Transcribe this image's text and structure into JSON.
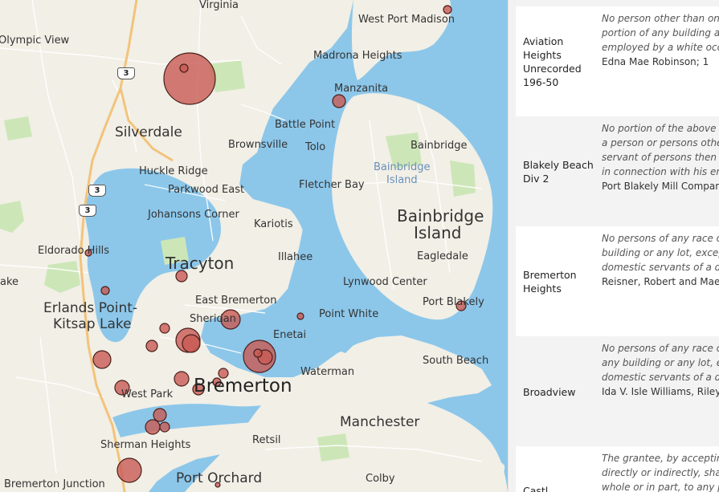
{
  "map": {
    "places": [
      {
        "name": "Virginia"
      },
      {
        "name": "West Port Madison"
      },
      {
        "name": "Olympic View"
      },
      {
        "name": "Madrona Heights"
      },
      {
        "name": "Manzanita"
      },
      {
        "name": "Silverdale"
      },
      {
        "name": "Battle Point"
      },
      {
        "name": "Brownsville"
      },
      {
        "name": "Tolo"
      },
      {
        "name": "Bainbridge"
      },
      {
        "name": "Huckle Ridge"
      },
      {
        "name": "Bainbridge"
      },
      {
        "name": "Island"
      },
      {
        "name": "Parkwood East"
      },
      {
        "name": "Fletcher Bay"
      },
      {
        "name": "Johansons Corner"
      },
      {
        "name": "Bainbridge"
      },
      {
        "name": "Island"
      },
      {
        "name": "Kariotis"
      },
      {
        "name": "Eldorado Hills"
      },
      {
        "name": "Tracyton"
      },
      {
        "name": "Illahee"
      },
      {
        "name": "Eagledale"
      },
      {
        "name": "Lynwood Center"
      },
      {
        "name": "ake"
      },
      {
        "name": "East Bremerton"
      },
      {
        "name": "Erlands Point-"
      },
      {
        "name": "Kitsap Lake"
      },
      {
        "name": "Port Blakely"
      },
      {
        "name": "Point White"
      },
      {
        "name": "Sheridan"
      },
      {
        "name": "Enetai"
      },
      {
        "name": "South Beach"
      },
      {
        "name": "Waterman"
      },
      {
        "name": "West Park"
      },
      {
        "name": "Bremerton"
      },
      {
        "name": "Manchester"
      },
      {
        "name": "Sherman Heights"
      },
      {
        "name": "Retsil"
      },
      {
        "name": "Port Orchard"
      },
      {
        "name": "Colby"
      },
      {
        "name": "Bremerton Junction"
      }
    ],
    "highways": [
      "3",
      "3",
      "3"
    ],
    "colors": {
      "water": "#8cc7ea",
      "land": "#f1efe6",
      "park": "#cde6b8",
      "road": "#ffffff",
      "highway": "#f3c37b",
      "marker": "#c85a54"
    }
  },
  "panel": {
    "rows": [
      {
        "name": "Aviation Heights Unrecorded 196-50",
        "lines": [
          "No person other than on",
          "portion of any building a",
          "employed by a white occ"
        ],
        "signers": "Edna Mae Robinson;   1"
      },
      {
        "name": "Blakely Beach Div 2",
        "lines": [
          "No portion of the above p",
          "a person or persons othe",
          "servant of persons then",
          "in connection with his en"
        ],
        "signers": "Port Blakely Mill Compan"
      },
      {
        "name": "Bremerton Heights",
        "lines": [
          "No persons of any race o",
          "building or any lot, excep",
          "domestic servants of a d"
        ],
        "signers": "Reisner, Robert and Mae"
      },
      {
        "name": "Broadview",
        "lines": [
          "No persons of any race o",
          "any building or any lot, e",
          "domestic servants of a d"
        ],
        "signers": "Ida V. Isle Williams, Riley"
      },
      {
        "name": "Castl",
        "lines": [
          "The grantee, by acceptin",
          "directly or indirectly, sha",
          "whole or in part, to any p"
        ],
        "signers": ""
      }
    ]
  }
}
